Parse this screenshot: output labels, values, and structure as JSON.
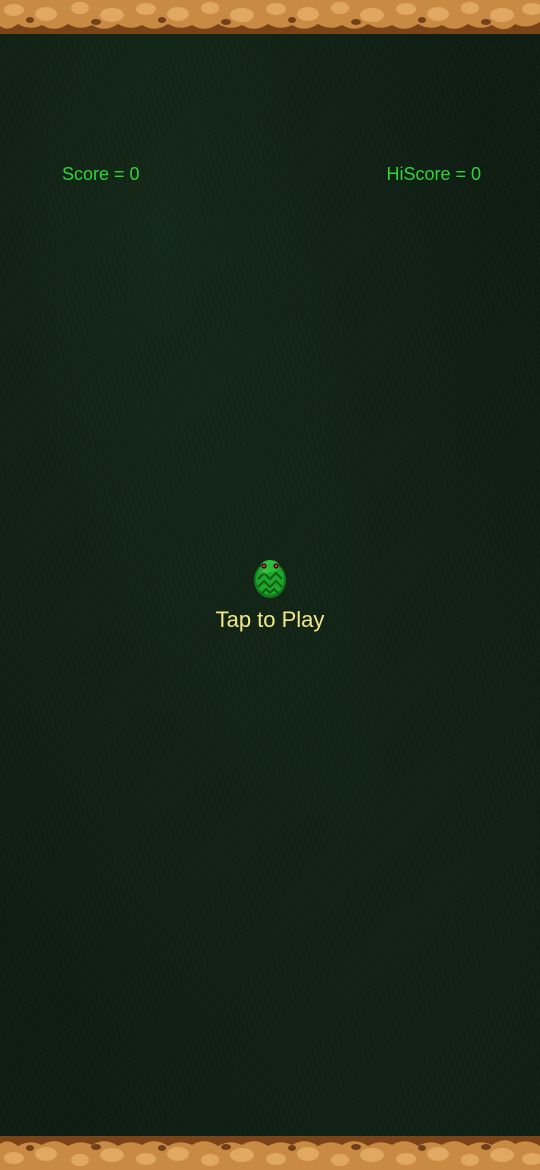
{
  "hud": {
    "score_text": "Score = 0",
    "hiscore_text": "HiScore = 0"
  },
  "start_screen": {
    "prompt": "Tap to Play",
    "mascot_icon": "snake-head-icon"
  },
  "colors": {
    "background": "#0f1d13",
    "score_text": "#2fd43a",
    "prompt_text": "#f2e88a",
    "border_rock": "#c07a35",
    "snake_green": "#1fa52b"
  }
}
